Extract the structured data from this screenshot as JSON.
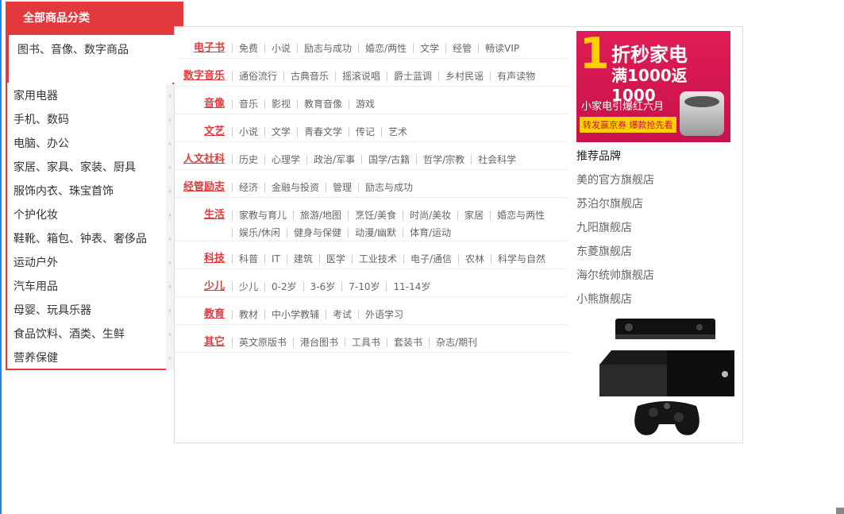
{
  "menu": {
    "header": "全部商品分类",
    "active": "图书、音像、数字商品",
    "items": [
      {
        "label": "家用电器"
      },
      {
        "label": "手机、数码"
      },
      {
        "label": "电脑、办公"
      },
      {
        "label": "家居、家具、家装、厨具"
      },
      {
        "label": "服饰内衣、珠宝首饰"
      },
      {
        "label": "个护化妆"
      },
      {
        "label": "鞋靴、箱包、钟表、奢侈品"
      },
      {
        "label": "运动户外"
      },
      {
        "label": "汽车用品"
      },
      {
        "label": "母婴、玩具乐器"
      },
      {
        "label": "食品饮料、酒类、生鲜"
      },
      {
        "label": "营养保健"
      }
    ],
    "arrow": "›"
  },
  "dropdown": {
    "rows": [
      {
        "title": "电子书",
        "links": [
          "免费",
          "小说",
          "励志与成功",
          "婚恋/两性",
          "文学",
          "经管",
          "畅读VIP"
        ]
      },
      {
        "title": "数字音乐",
        "links": [
          "通俗流行",
          "古典音乐",
          "摇滚说唱",
          "爵士蓝调",
          "乡村民谣",
          "有声读物"
        ]
      },
      {
        "title": "音像",
        "links": [
          "音乐",
          "影视",
          "教育音像",
          "游戏"
        ]
      },
      {
        "title": "文艺",
        "links": [
          "小说",
          "文学",
          "青春文学",
          "传记",
          "艺术"
        ]
      },
      {
        "title": "人文社科",
        "links": [
          "历史",
          "心理学",
          "政治/军事",
          "国学/古籍",
          "哲学/宗教",
          "社会科学"
        ]
      },
      {
        "title": "经管励志",
        "links": [
          "经济",
          "金融与投资",
          "管理",
          "励志与成功"
        ]
      },
      {
        "title": "生活",
        "links": [
          "家教与育儿",
          "旅游/地图",
          "烹饪/美食",
          "时尚/美妆",
          "家居",
          "婚恋与两性",
          "娱乐/休闲",
          "健身与保健",
          "动漫/幽默",
          "体育/运动"
        ]
      },
      {
        "title": "科技",
        "links": [
          "科普",
          "IT",
          "建筑",
          "医学",
          "工业技术",
          "电子/通信",
          "农林",
          "科学与自然"
        ]
      },
      {
        "title": "少儿",
        "links": [
          "少儿",
          "0-2岁",
          "3-6岁",
          "7-10岁",
          "11-14岁"
        ]
      },
      {
        "title": "教育",
        "links": [
          "教材",
          "中小学教辅",
          "考试",
          "外语学习"
        ]
      },
      {
        "title": "其它",
        "links": [
          "英文原版书",
          "港台图书",
          "工具书",
          "套装书",
          "杂志/期刊"
        ]
      }
    ]
  },
  "ad": {
    "digit": "1",
    "line1": "折秒家电",
    "line2": "满1000返1000",
    "line3": "小家电引爆红六月",
    "line4": "转发赢京券 爆款抢先看"
  },
  "brands": {
    "title": "推荐品牌",
    "items": [
      "美的官方旗舰店",
      "苏泊尔旗舰店",
      "九阳旗舰店",
      "东菱旗舰店",
      "海尔统帅旗舰店",
      "小熊旗舰店"
    ]
  },
  "colors": {
    "accent": "#e4393c",
    "link": "#666666"
  }
}
